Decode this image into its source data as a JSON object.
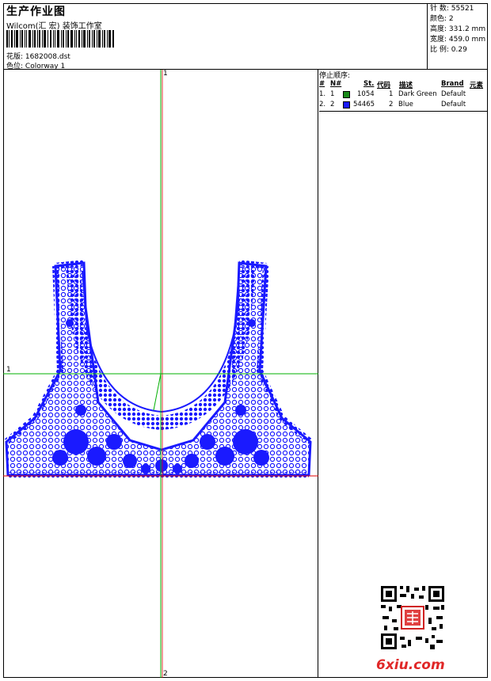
{
  "header": {
    "title": "生产作业图",
    "software": "Wilcom(汇 宏) 装饰工作室",
    "file_label": "花版:",
    "file_value": "1682008.dst",
    "color_label": "色位:",
    "color_value": "Colorway 1"
  },
  "stats": [
    {
      "label": "针 数:",
      "value": "55521"
    },
    {
      "label": "颜色:",
      "value": "2"
    },
    {
      "label": "高度:",
      "value": "331.2 mm"
    },
    {
      "label": "宽度:",
      "value": "459.0 mm"
    },
    {
      "label": "比 例:",
      "value": "0.29"
    }
  ],
  "stop_sequence": {
    "title": "停止顺序:",
    "headers": [
      "#",
      "N#",
      "St.",
      "代码",
      "描述",
      "Brand",
      "元素"
    ],
    "rows": [
      {
        "num": "1.",
        "n": "1",
        "color": "#1a8a1a",
        "stitches": "1054",
        "code": "1",
        "desc": "Dark Green",
        "brand": "Default"
      },
      {
        "num": "2.",
        "n": "2",
        "color": "#1a1aff",
        "stitches": "54465",
        "code": "2",
        "desc": "Blue",
        "brand": "Default"
      }
    ]
  },
  "axes": {
    "v_top": "1",
    "v_bottom": "2",
    "h_left": "1"
  },
  "colors": {
    "design": "#1a1aff",
    "axis_green": "#00b000",
    "axis_red": "#e00000"
  },
  "watermark": "6xiu.com",
  "icons": {
    "qr": "qr-code-icon",
    "seal": "red-seal-icon"
  }
}
